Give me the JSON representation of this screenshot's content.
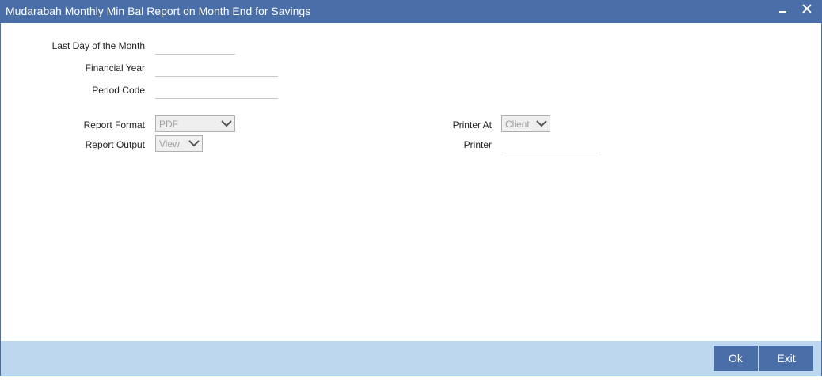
{
  "window": {
    "title": "Mudarabah Monthly Min Bal Report on Month End for Savings",
    "minimize_icon": "minimize-icon",
    "close_icon": "close-icon"
  },
  "form": {
    "last_day": {
      "label": "Last Day of the Month",
      "value": ""
    },
    "financial_year": {
      "label": "Financial Year",
      "value": ""
    },
    "period_code": {
      "label": "Period Code",
      "value": ""
    },
    "report_format": {
      "label": "Report Format",
      "selected": "PDF"
    },
    "report_output": {
      "label": "Report Output",
      "selected": "View"
    },
    "printer_at": {
      "label": "Printer At",
      "selected": "Client"
    },
    "printer": {
      "label": "Printer",
      "value": ""
    }
  },
  "footer": {
    "ok_label": "Ok",
    "exit_label": "Exit"
  },
  "colors": {
    "titlebar": "#4a6ea8",
    "footer": "#bdd7ee",
    "button": "#4a6ea8"
  }
}
